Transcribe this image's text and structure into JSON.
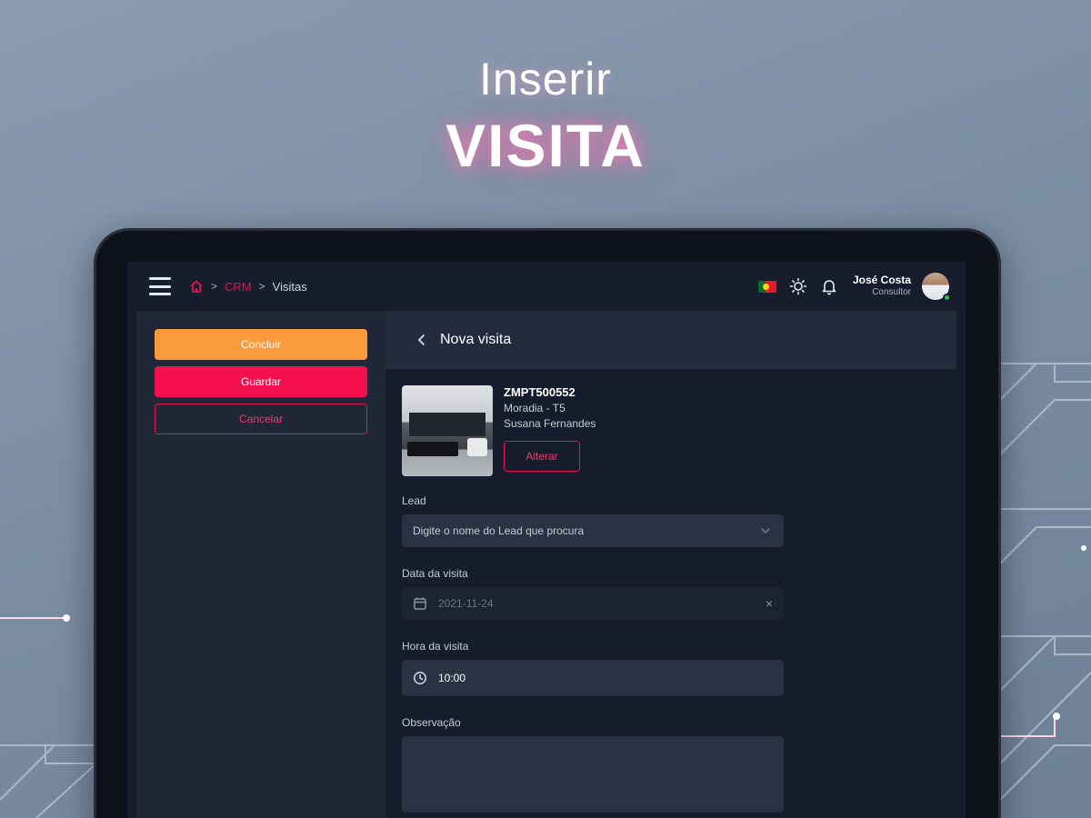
{
  "headline": {
    "line1": "Inserir",
    "line2": "VISITA"
  },
  "topbar": {
    "breadcrumb": {
      "section": "CRM",
      "current": "Visitas"
    },
    "user": {
      "name": "José Costa",
      "role": "Consultor"
    }
  },
  "left_panel": {
    "concluir_label": "Concluir",
    "guardar_label": "Guardar",
    "cancelar_label": "Cancelar"
  },
  "right_panel": {
    "title": "Nova visita",
    "property": {
      "reference": "ZMPT500552",
      "type": "Moradia - T5",
      "owner": "Susana Fernandes",
      "change_label": "Alterar"
    },
    "fields": {
      "lead": {
        "label": "Lead",
        "placeholder": "Digite o nome do Lead que procura"
      },
      "date": {
        "label": "Data da visita",
        "value": "2021-11-24"
      },
      "time": {
        "label": "Hora da visita",
        "value": "10:00"
      },
      "notes": {
        "label": "Observação"
      }
    }
  },
  "colors": {
    "accent_red": "#e0144e",
    "orange": "#fb9a3a",
    "panel": "#202838",
    "screen": "#161c2b"
  }
}
